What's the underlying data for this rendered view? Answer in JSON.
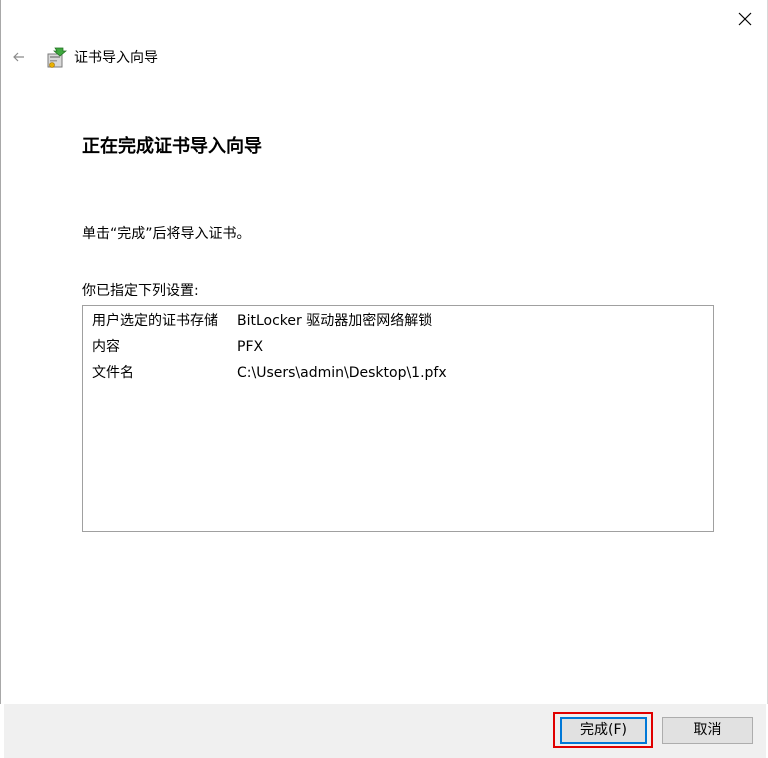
{
  "window": {
    "title": "证书导入向导"
  },
  "icons": {
    "close": "close-icon",
    "back": "back-arrow-icon",
    "wizard": "certificate-wizard-icon"
  },
  "page": {
    "heading": "正在完成证书导入向导",
    "instruction": "单击“完成”后将导入证书。",
    "settings_label": "你已指定下列设置:"
  },
  "settings": [
    {
      "key": "用户选定的证书存储",
      "value": "BitLocker 驱动器加密网络解锁"
    },
    {
      "key": "内容",
      "value": "PFX"
    },
    {
      "key": "文件名",
      "value": "C:\\Users\\admin\\Desktop\\1.pfx"
    }
  ],
  "buttons": {
    "finish": "完成(F)",
    "cancel": "取消"
  },
  "colors": {
    "highlight": "#e00000",
    "focus_border": "#0078d7",
    "footer_bg": "#f0f0f0"
  }
}
